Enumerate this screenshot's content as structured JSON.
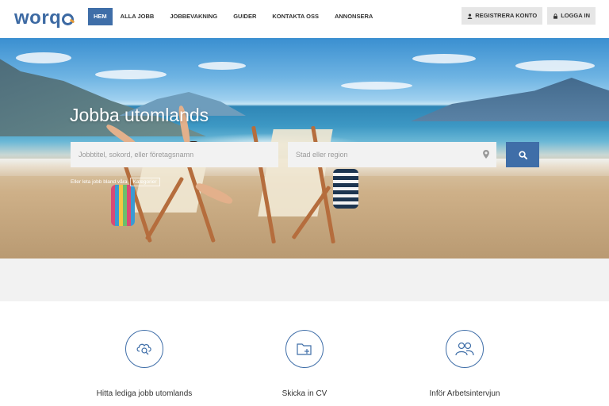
{
  "logo": {
    "text_before": "worq",
    "text_after": ""
  },
  "nav": {
    "items": [
      {
        "label": "HEM",
        "active": true
      },
      {
        "label": "ALLA JOBB",
        "active": false
      },
      {
        "label": "JOBBEVAKNING",
        "active": false
      },
      {
        "label": "GUIDER",
        "active": false
      },
      {
        "label": "KONTAKTA OSS",
        "active": false
      },
      {
        "label": "ANNONSERA",
        "active": false
      }
    ]
  },
  "auth": {
    "register_label": "REGISTRERA KONTO",
    "login_label": "LOGGA IN"
  },
  "hero": {
    "title": "Jobba utomlands",
    "job_placeholder": "Jobbtitel, sokord, eller företagsnamn",
    "location_placeholder": "Stad eller region",
    "hint_text": "Eller leta jobb bland våra",
    "hint_link": "Kategorier"
  },
  "features": [
    {
      "label": "Hitta lediga jobb utomlands",
      "icon": "cloud-search-icon"
    },
    {
      "label": "Skicka in CV",
      "icon": "folder-add-icon"
    },
    {
      "label": "Inför Arbetsintervjun",
      "icon": "people-icon"
    }
  ],
  "colors": {
    "brand": "#3f6ea8",
    "logo_accent": "#e59b39",
    "band": "#f2f2f2"
  }
}
